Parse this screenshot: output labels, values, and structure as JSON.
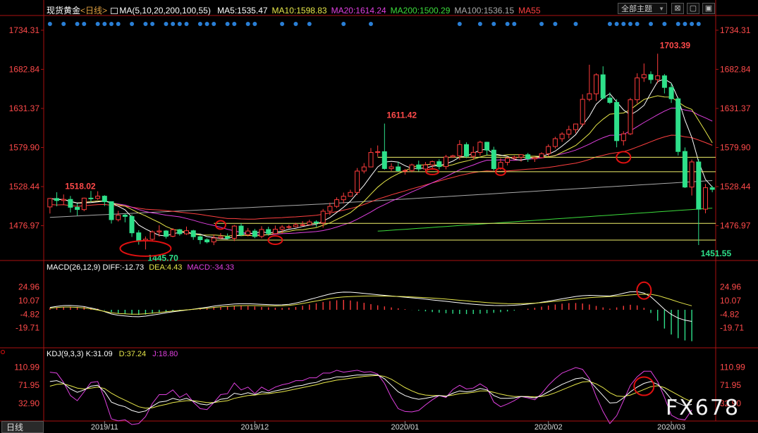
{
  "header": {
    "title": "现货黄金",
    "period_link": "<日线>",
    "ma_spec": "MA(5,10,20,200,100,55)",
    "ma_values": [
      {
        "text": "MA5:1535.47",
        "color": "#ffffff"
      },
      {
        "text": "MA10:1598.83",
        "color": "#e8e84a"
      },
      {
        "text": "MA20:1614.24",
        "color": "#e040e0"
      },
      {
        "text": "MA200:1500.29",
        "color": "#3cdc3c"
      },
      {
        "text": "MA100:1536.15",
        "color": "#aaaaaa"
      },
      {
        "text": "MA55",
        "color": "#ff4040"
      }
    ],
    "theme_button": "全部主题",
    "window_buttons": [
      "⊠",
      "▢",
      "▣"
    ]
  },
  "macd": {
    "label": "MACD(26,12,9)",
    "diff": "DIFF:-12.73",
    "dea": "DEA:4.43",
    "macd": "MACD:-34.33"
  },
  "kdj": {
    "label": "KDJ(9,3,3)",
    "k": "K:31.09",
    "d": "D:37.24",
    "j": "J:18.80"
  },
  "tab": "日线",
  "watermark": "FX678",
  "colors": {
    "up": "#ff3c3c",
    "down": "#2ee08a",
    "axis": "#aa1111",
    "price_text": "#ff4a4a",
    "low_text": "#2ee08a"
  },
  "chart_data": {
    "type": "candlestick",
    "x_labels": [
      "2019/11",
      "2019/12",
      "2020/01",
      "2020/02",
      "2020/03"
    ],
    "price_axis": {
      "ticks": [
        "1734.31",
        "1682.84",
        "1631.37",
        "1579.90",
        "1528.44",
        "1476.97"
      ],
      "range": [
        1433,
        1750
      ]
    },
    "macd_axis": {
      "ticks": [
        "24.96",
        "10.07",
        "-4.82",
        "-19.71"
      ],
      "range": [
        -40,
        40
      ]
    },
    "kdj_axis": {
      "ticks": [
        "110.99",
        "71.95",
        "32.90"
      ],
      "range": [
        0,
        125
      ]
    },
    "annotations": [
      {
        "text": "1518.02",
        "price": 1518.02
      },
      {
        "text": "1445.70",
        "price": 1445.7
      },
      {
        "text": "1611.42",
        "price": 1611.42
      },
      {
        "text": "1703.39",
        "price": 1703.39
      },
      {
        "text": "1451.55",
        "price": 1451.55
      }
    ],
    "horizontal_lines": [
      1567,
      1548,
      1480,
      1458
    ],
    "candles": [
      [
        1501.7,
        1512.8,
        1493.0,
        1512.8
      ],
      [
        1512.8,
        1510.1,
        1502.5,
        1521.0
      ],
      [
        1510.1,
        1511.6,
        1504.8,
        1518.1
      ],
      [
        1511.6,
        1501.2,
        1494.4,
        1516.1
      ],
      [
        1501.2,
        1498.2,
        1490.2,
        1506.3
      ],
      [
        1498.2,
        1513.3,
        1496.0,
        1513.9
      ],
      [
        1513.3,
        1512.9,
        1508.2,
        1522.7
      ],
      [
        1512.9,
        1515.9,
        1511.0,
        1522.3
      ],
      [
        1515.9,
        1508.6,
        1502.9,
        1517.1
      ],
      [
        1508.6,
        1484.9,
        1479.8,
        1508.8
      ],
      [
        1484.9,
        1490.9,
        1482.5,
        1496.5
      ],
      [
        1490.9,
        1489.1,
        1481.4,
        1492.5
      ],
      [
        1489.1,
        1467.6,
        1462.2,
        1491.7
      ],
      [
        1467.6,
        1456.6,
        1452.0,
        1471.0
      ],
      [
        1456.6,
        1459.1,
        1445.7,
        1462.8
      ],
      [
        1459.1,
        1468.8,
        1456.8,
        1470.8
      ],
      [
        1468.8,
        1470.1,
        1462.5,
        1477.5
      ],
      [
        1470.1,
        1463.0,
        1460.1,
        1471.2
      ],
      [
        1463.0,
        1471.7,
        1461.8,
        1473.8
      ],
      [
        1471.7,
        1466.3,
        1463.9,
        1472.7
      ],
      [
        1466.3,
        1470.4,
        1464.8,
        1475.8
      ],
      [
        1470.4,
        1462.5,
        1458.4,
        1471.6
      ],
      [
        1462.5,
        1458.5,
        1452.8,
        1464.3
      ],
      [
        1458.5,
        1455.6,
        1453.7,
        1460.4
      ],
      [
        1455.6,
        1460.8,
        1451.4,
        1465.3
      ],
      [
        1460.8,
        1462.5,
        1459.5,
        1467.2
      ],
      [
        1462.5,
        1460.4,
        1458.8,
        1466.7
      ],
      [
        1460.4,
        1476.5,
        1456.7,
        1477.9
      ],
      [
        1476.5,
        1465.0,
        1463.1,
        1480.4
      ],
      [
        1465.0,
        1470.0,
        1462.8,
        1474.0
      ],
      [
        1470.0,
        1462.8,
        1460.4,
        1472.8
      ],
      [
        1462.8,
        1471.9,
        1460.3,
        1476.3
      ],
      [
        1471.9,
        1466.5,
        1463.8,
        1475.6
      ],
      [
        1466.5,
        1472.3,
        1465.9,
        1477.1
      ],
      [
        1472.3,
        1475.1,
        1466.3,
        1477.8
      ],
      [
        1475.1,
        1475.6,
        1473.1,
        1478.3
      ],
      [
        1475.6,
        1478.2,
        1474.7,
        1480.9
      ],
      [
        1478.2,
        1478.2,
        1476.6,
        1482.9
      ],
      [
        1478.2,
        1481.9,
        1478.0,
        1484.7
      ],
      [
        1481.9,
        1480.6,
        1475.4,
        1484.1
      ],
      [
        1480.6,
        1496.0,
        1474.4,
        1499.0
      ],
      [
        1496.0,
        1502.4,
        1490.7,
        1507.3
      ],
      [
        1502.4,
        1511.2,
        1500.3,
        1514.3
      ],
      [
        1511.2,
        1515.7,
        1506.3,
        1520.5
      ],
      [
        1515.7,
        1520.8,
        1515.4,
        1524.3
      ],
      [
        1520.8,
        1548.9,
        1517.3,
        1552.9
      ],
      [
        1548.9,
        1554.3,
        1545.8,
        1559.4
      ],
      [
        1554.3,
        1573.3,
        1553.9,
        1579.2
      ],
      [
        1573.3,
        1574.4,
        1567.9,
        1582.6
      ],
      [
        1574.4,
        1552.2,
        1550.7,
        1611.4
      ],
      [
        1552.2,
        1554.4,
        1549.1,
        1559.2
      ],
      [
        1554.4,
        1549.4,
        1548.2,
        1561.4
      ],
      [
        1549.4,
        1549.6,
        1544.3,
        1551.7
      ],
      [
        1549.6,
        1557.0,
        1547.3,
        1558.7
      ],
      [
        1557.0,
        1551.6,
        1548.4,
        1562.6
      ],
      [
        1551.6,
        1557.0,
        1548.1,
        1560.8
      ],
      [
        1557.0,
        1561.3,
        1550.7,
        1562.7
      ],
      [
        1561.3,
        1554.8,
        1551.1,
        1564.5
      ],
      [
        1554.8,
        1567.5,
        1551.2,
        1570.2
      ],
      [
        1567.5,
        1569.0,
        1566.9,
        1570.4
      ],
      [
        1569.0,
        1583.8,
        1563.9,
        1589.6
      ],
      [
        1583.8,
        1568.4,
        1566.0,
        1586.7
      ],
      [
        1568.4,
        1573.5,
        1563.9,
        1581.4
      ],
      [
        1573.5,
        1586.9,
        1569.2,
        1588.8
      ],
      [
        1586.9,
        1576.5,
        1570.0,
        1587.5
      ],
      [
        1576.5,
        1552.1,
        1549.6,
        1580.9
      ],
      [
        1552.1,
        1560.3,
        1550.7,
        1565.9
      ],
      [
        1560.3,
        1565.7,
        1556.4,
        1567.7
      ],
      [
        1565.7,
        1567.2,
        1563.3,
        1569.2
      ],
      [
        1567.2,
        1570.5,
        1561.2,
        1570.8
      ],
      [
        1570.5,
        1565.0,
        1561.0,
        1572.8
      ],
      [
        1565.0,
        1566.6,
        1560.9,
        1567.5
      ],
      [
        1566.6,
        1571.8,
        1565.8,
        1573.6
      ],
      [
        1571.8,
        1581.2,
        1568.2,
        1584.1
      ],
      [
        1581.2,
        1591.5,
        1578.7,
        1594.0
      ],
      [
        1591.5,
        1597.6,
        1587.4,
        1600.1
      ],
      [
        1597.6,
        1603.5,
        1591.9,
        1608.6
      ],
      [
        1603.5,
        1610.9,
        1598.7,
        1611.4
      ],
      [
        1610.9,
        1643.3,
        1607.6,
        1650.0
      ],
      [
        1643.3,
        1650.7,
        1640.8,
        1688.9
      ],
      [
        1650.7,
        1675.7,
        1641.4,
        1677.6
      ],
      [
        1675.7,
        1645.1,
        1643.2,
        1686.8
      ],
      [
        1645.1,
        1639.3,
        1637.2,
        1652.4
      ],
      [
        1639.3,
        1588.9,
        1580.2,
        1643.6
      ],
      [
        1588.9,
        1597.9,
        1582.6,
        1601.3
      ],
      [
        1597.9,
        1642.8,
        1596.3,
        1645.3
      ],
      [
        1642.8,
        1671.5,
        1637.9,
        1677.6
      ],
      [
        1671.5,
        1675.9,
        1666.3,
        1690.5
      ],
      [
        1675.9,
        1669.3,
        1664.1,
        1680.2
      ],
      [
        1669.3,
        1674.3,
        1664.4,
        1703.4
      ],
      [
        1674.3,
        1659.0,
        1651.1,
        1676.7
      ],
      [
        1659.0,
        1644.1,
        1638.6,
        1664.5
      ],
      [
        1644.1,
        1574.7,
        1569.4,
        1646.1
      ],
      [
        1574.7,
        1527.8,
        1526.6,
        1580.0
      ],
      [
        1527.8,
        1560.9,
        1516.7,
        1564.0
      ],
      [
        1560.9,
        1498.7,
        1451.5,
        1564.4
      ],
      [
        1498.7,
        1527.0,
        1493.3,
        1531.9
      ],
      [
        1527.0,
        1524.8,
        1521.0,
        1529.4
      ]
    ],
    "macd_hist": [
      1.8,
      2.5,
      3.1,
      3.4,
      3.2,
      3.0,
      2.2,
      1.2,
      -0.5,
      -2.6,
      -3.9,
      -4.6,
      -5.2,
      -5.6,
      -5.2,
      -4.2,
      -3.3,
      -2.4,
      -1.6,
      -0.9,
      -0.3,
      0.4,
      1.1,
      1.9,
      2.8,
      3.4,
      3.8,
      4.1,
      4.2,
      4.0,
      3.6,
      3.1,
      2.7,
      2.3,
      2.1,
      2.3,
      3.1,
      4.4,
      5.8,
      7.1,
      8.5,
      9.6,
      10.4,
      10.8,
      10.2,
      9.0,
      7.6,
      6.2,
      4.9,
      3.7,
      2.6,
      1.6,
      0.7,
      -0.1,
      -0.9,
      -1.7,
      -2.5,
      -3.2,
      -3.8,
      -4.3,
      -4.6,
      -4.7,
      -4.6,
      -4.3,
      -3.9,
      -3.3,
      -2.6,
      -1.8,
      -0.9,
      0.1,
      1.1,
      2.2,
      3.4,
      4.6,
      5.8,
      6.7,
      7.3,
      7.4,
      6.9,
      5.8,
      4.2,
      2.6,
      1.2,
      2.6,
      4.3,
      5.5,
      4.8,
      2.1,
      -3.5,
      -12.0,
      -20.5,
      -27.0,
      -31.0,
      -33.5,
      -34.3
    ],
    "macd_diff": [
      2.6,
      3.8,
      4.6,
      4.7,
      4.2,
      3.5,
      2.0,
      0.3,
      -2.1,
      -4.6,
      -6.0,
      -6.7,
      -7.4,
      -7.6,
      -6.9,
      -5.8,
      -4.6,
      -3.3,
      -2.2,
      -1.2,
      -0.3,
      0.7,
      1.7,
      2.8,
      4.0,
      5.0,
      5.7,
      6.3,
      6.6,
      6.6,
      6.3,
      6.0,
      5.7,
      5.4,
      5.5,
      6.0,
      7.3,
      9.1,
      11.2,
      13.2,
      15.3,
      17.2,
      18.6,
      19.3,
      19.2,
      18.6,
      17.9,
      17.2,
      16.5,
      15.8,
      15.1,
      14.4,
      13.8,
      13.1,
      12.4,
      11.6,
      10.8,
      10.0,
      9.2,
      8.4,
      7.6,
      6.8,
      6.1,
      5.5,
      5.0,
      4.7,
      4.6,
      4.7,
      5.0,
      5.5,
      6.2,
      7.1,
      8.2,
      9.4,
      10.7,
      12.0,
      13.3,
      14.5,
      15.4,
      15.8,
      15.6,
      15.3,
      15.1,
      16.3,
      18.1,
      19.7,
      19.8,
      18.3,
      14.2,
      7.5,
      0.5,
      -5.1,
      -9.0,
      -11.4,
      -12.7
    ],
    "macd_dea": [
      1.7,
      2.5,
      3.0,
      3.0,
      2.6,
      2.0,
      0.9,
      -0.3,
      -1.8,
      -3.3,
      -4.1,
      -4.4,
      -4.8,
      -4.8,
      -4.3,
      -3.7,
      -2.9,
      -2.1,
      -1.4,
      -0.7,
      -0.1,
      0.5,
      1.2,
      1.8,
      2.6,
      3.3,
      3.8,
      4.2,
      4.5,
      4.6,
      4.5,
      4.4,
      4.3,
      4.2,
      4.4,
      4.8,
      5.7,
      6.9,
      8.3,
      9.6,
      11.0,
      12.4,
      13.4,
      14.0,
      14.4,
      14.7,
      15.0,
      15.1,
      15.1,
      15.0,
      14.8,
      14.6,
      14.4,
      14.1,
      13.7,
      13.3,
      12.8,
      12.3,
      11.7,
      11.1,
      10.4,
      9.8,
      9.1,
      8.5,
      7.9,
      7.4,
      7.0,
      6.7,
      6.6,
      6.7,
      6.9,
      7.3,
      7.8,
      8.5,
      9.3,
      10.1,
      10.9,
      11.8,
      12.5,
      13.3,
      13.8,
      14.1,
      14.4,
      14.9,
      15.6,
      16.2,
      16.7,
      17.0,
      16.9,
      15.6,
      13.4,
      11.1,
      8.6,
      6.4,
      4.4
    ],
    "kdj_k": [
      80,
      82,
      76,
      64,
      57,
      62,
      70,
      72,
      58,
      36,
      30,
      26,
      18,
      14,
      17,
      27,
      36,
      38,
      44,
      40,
      44,
      38,
      32,
      30,
      35,
      42,
      44,
      55,
      52,
      56,
      52,
      58,
      56,
      60,
      63,
      66,
      70,
      72,
      76,
      78,
      84,
      86,
      90,
      90,
      92,
      94,
      94,
      95,
      94,
      86,
      72,
      58,
      50,
      45,
      42,
      44,
      47,
      50,
      48,
      55,
      60,
      58,
      60,
      65,
      62,
      50,
      44,
      44,
      45,
      48,
      47,
      45,
      50,
      58,
      66,
      74,
      80,
      86,
      88,
      82,
      66,
      50,
      34,
      35,
      45,
      58,
      68,
      76,
      80,
      74,
      60,
      42,
      34,
      28,
      31
    ],
    "kdj_d": [
      70,
      74,
      75,
      71,
      66,
      64,
      66,
      68,
      65,
      55,
      47,
      40,
      33,
      26,
      23,
      24,
      28,
      31,
      35,
      37,
      39,
      39,
      37,
      35,
      35,
      37,
      39,
      44,
      47,
      50,
      51,
      53,
      54,
      56,
      58,
      61,
      64,
      67,
      70,
      73,
      77,
      80,
      83,
      85,
      87,
      89,
      91,
      92,
      93,
      91,
      85,
      76,
      67,
      60,
      54,
      51,
      50,
      50,
      49,
      51,
      54,
      55,
      57,
      60,
      60,
      57,
      53,
      50,
      48,
      48,
      48,
      47,
      48,
      51,
      56,
      62,
      68,
      74,
      79,
      80,
      75,
      67,
      56,
      49,
      48,
      51,
      57,
      63,
      69,
      71,
      67,
      59,
      51,
      43,
      37
    ],
    "kdj_j": [
      100,
      98,
      78,
      50,
      39,
      58,
      78,
      80,
      44,
      0,
      -4,
      -2,
      -12,
      -10,
      5,
      33,
      52,
      52,
      62,
      46,
      54,
      36,
      22,
      20,
      35,
      52,
      54,
      77,
      62,
      68,
      54,
      68,
      60,
      68,
      73,
      76,
      82,
      82,
      88,
      88,
      98,
      98,
      104,
      100,
      102,
      104,
      100,
      101,
      96,
      76,
      46,
      22,
      16,
      15,
      18,
      30,
      41,
      50,
      46,
      63,
      72,
      64,
      66,
      75,
      66,
      36,
      26,
      32,
      39,
      48,
      45,
      41,
      54,
      72,
      86,
      98,
      104,
      110,
      106,
      86,
      48,
      16,
      -10,
      7,
      39,
      72,
      90,
      102,
      102,
      80,
      46,
      8,
      0,
      -2,
      19
    ],
    "blue_dot_columns": [
      0,
      2,
      4,
      5,
      7,
      8,
      9,
      10,
      12,
      14,
      15,
      17,
      18,
      19,
      20,
      22,
      23,
      24,
      26,
      27,
      29,
      30,
      34,
      36,
      38,
      43,
      47,
      60,
      63,
      65,
      67,
      68,
      72,
      74,
      77,
      82,
      83,
      84,
      85,
      86,
      88,
      90,
      92,
      93,
      94,
      95
    ]
  }
}
